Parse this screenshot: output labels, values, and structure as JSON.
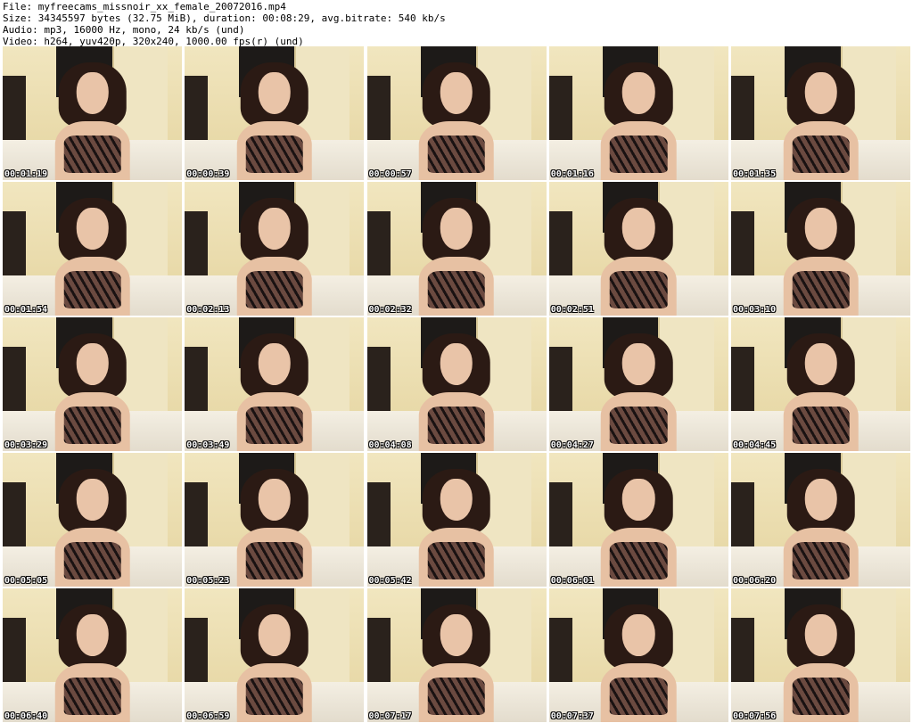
{
  "header": {
    "file_line": "File: myfreecams_missnoir_xx_female_20072016.mp4",
    "size_line": "Size: 34345597 bytes (32.75 MiB), duration: 00:08:29, avg.bitrate: 540 kb/s",
    "audio_line": "Audio: mp3, 16000 Hz, mono, 24 kb/s (und)",
    "video_line": "Video: h264, yuv420p, 320x240, 1000.00 fps(r) (und)"
  },
  "frames": [
    {
      "timestamp": "00:01:19"
    },
    {
      "timestamp": "00:00:39"
    },
    {
      "timestamp": "00:00:57"
    },
    {
      "timestamp": "00:01:16"
    },
    {
      "timestamp": "00:01:35"
    },
    {
      "timestamp": "00:01:54"
    },
    {
      "timestamp": "00:02:13"
    },
    {
      "timestamp": "00:02:32"
    },
    {
      "timestamp": "00:02:51"
    },
    {
      "timestamp": "00:03:10"
    },
    {
      "timestamp": "00:03:29"
    },
    {
      "timestamp": "00:03:49"
    },
    {
      "timestamp": "00:04:08"
    },
    {
      "timestamp": "00:04:27"
    },
    {
      "timestamp": "00:04:45"
    },
    {
      "timestamp": "00:05:05"
    },
    {
      "timestamp": "00:05:23"
    },
    {
      "timestamp": "00:05:42"
    },
    {
      "timestamp": "00:06:01"
    },
    {
      "timestamp": "00:06:20"
    },
    {
      "timestamp": "00:06:40"
    },
    {
      "timestamp": "00:06:59"
    },
    {
      "timestamp": "00:07:17"
    },
    {
      "timestamp": "00:07:37"
    },
    {
      "timestamp": "00:07:56"
    }
  ]
}
